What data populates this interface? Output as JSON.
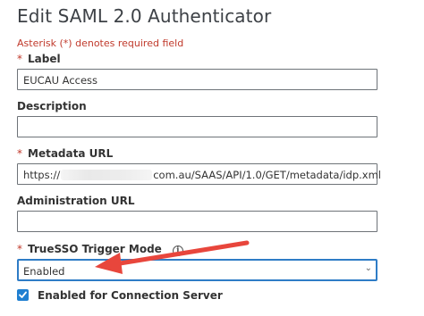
{
  "page": {
    "title": "Edit SAML 2.0 Authenticator",
    "required_note": "Asterisk (*) denotes required field"
  },
  "fields": {
    "label": {
      "star": "*",
      "label": "Label",
      "value": "EUCAU Access"
    },
    "description": {
      "label": "Description",
      "value": ""
    },
    "metadata_url": {
      "star": "*",
      "label": "Metadata URL",
      "value_prefix": "https://",
      "value_suffix": "com.au/SAAS/API/1.0/GET/metadata/idp.xml"
    },
    "admin_url": {
      "label": "Administration URL",
      "value": ""
    },
    "truesso": {
      "star": "*",
      "label": "TrueSSO Trigger Mode",
      "info_icon": "i",
      "selected": "Enabled",
      "chevron": "⌄"
    },
    "connection_server": {
      "label": "Enabled for Connection Server",
      "checked": true
    }
  },
  "colors": {
    "accent": "#1f7fd1",
    "required": "#c0392b",
    "arrow": "#e8463c"
  },
  "icons": [
    "info-icon",
    "chevron-down-icon",
    "checkmark-icon",
    "annotation-arrow"
  ]
}
